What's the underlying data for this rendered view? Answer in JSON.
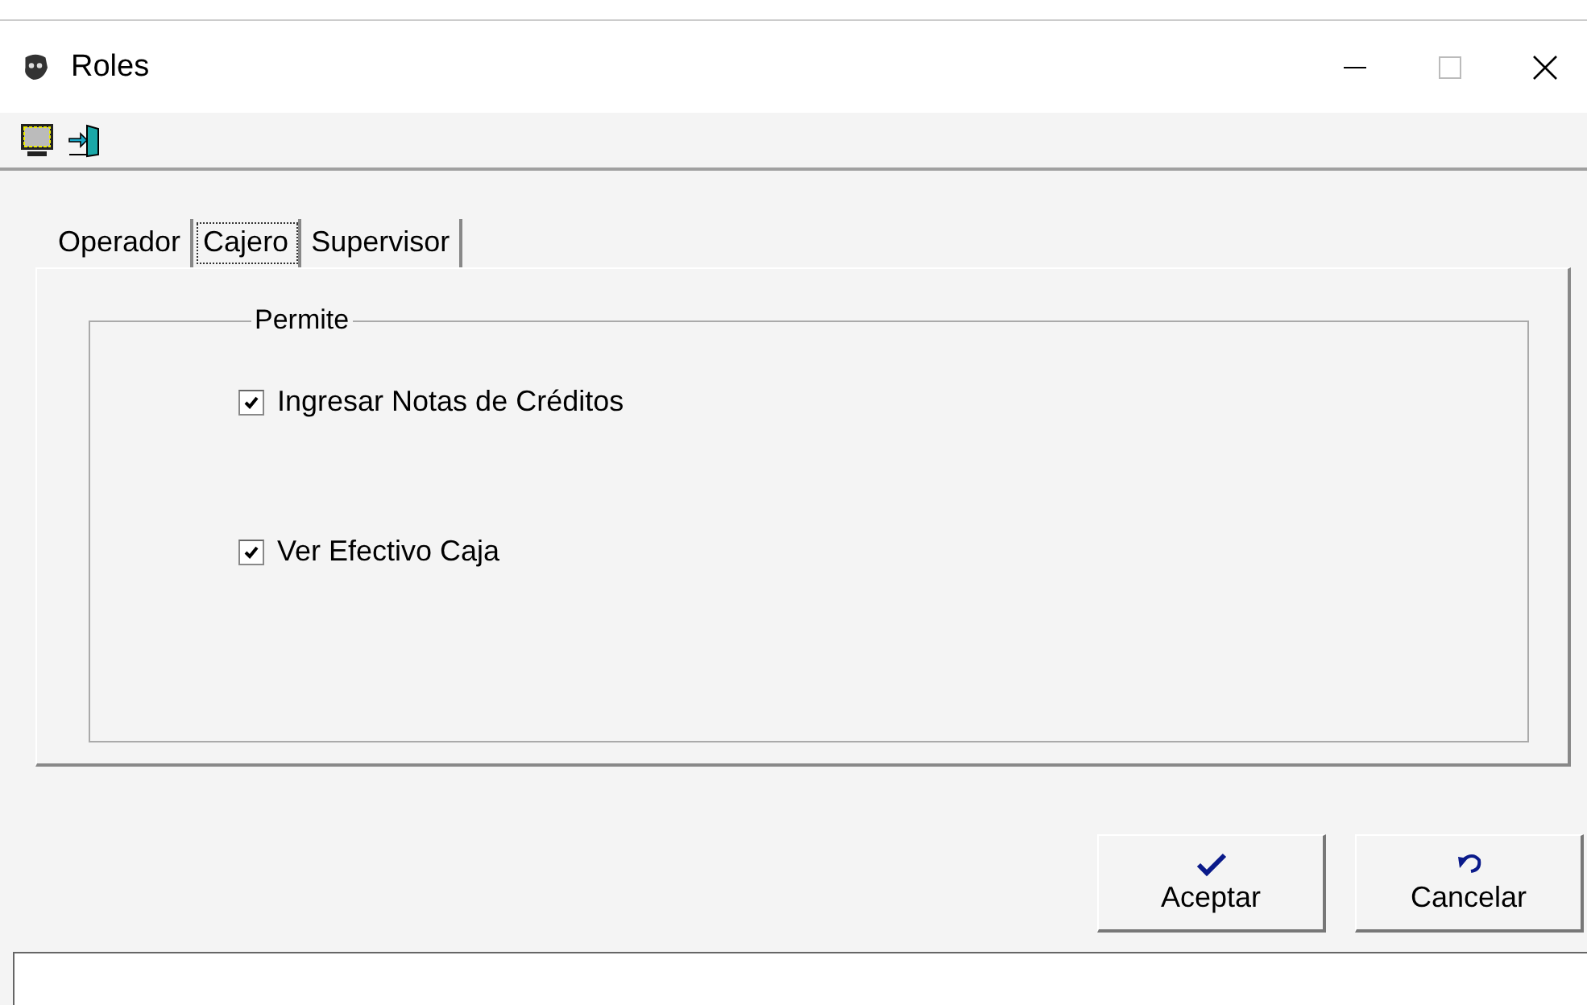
{
  "window": {
    "title": "Roles"
  },
  "tabs": [
    {
      "label": "Operador",
      "selected": false
    },
    {
      "label": "Cajero",
      "selected": true
    },
    {
      "label": "Supervisor",
      "selected": false
    }
  ],
  "group": {
    "title": "Permite",
    "options": [
      {
        "label": "Ingresar Notas de Créditos",
        "checked": true
      },
      {
        "label": "Ver Efectivo Caja",
        "checked": true
      }
    ]
  },
  "buttons": [
    {
      "kind": "accept",
      "label": "Aceptar"
    },
    {
      "kind": "cancel",
      "label": "Cancelar"
    }
  ]
}
